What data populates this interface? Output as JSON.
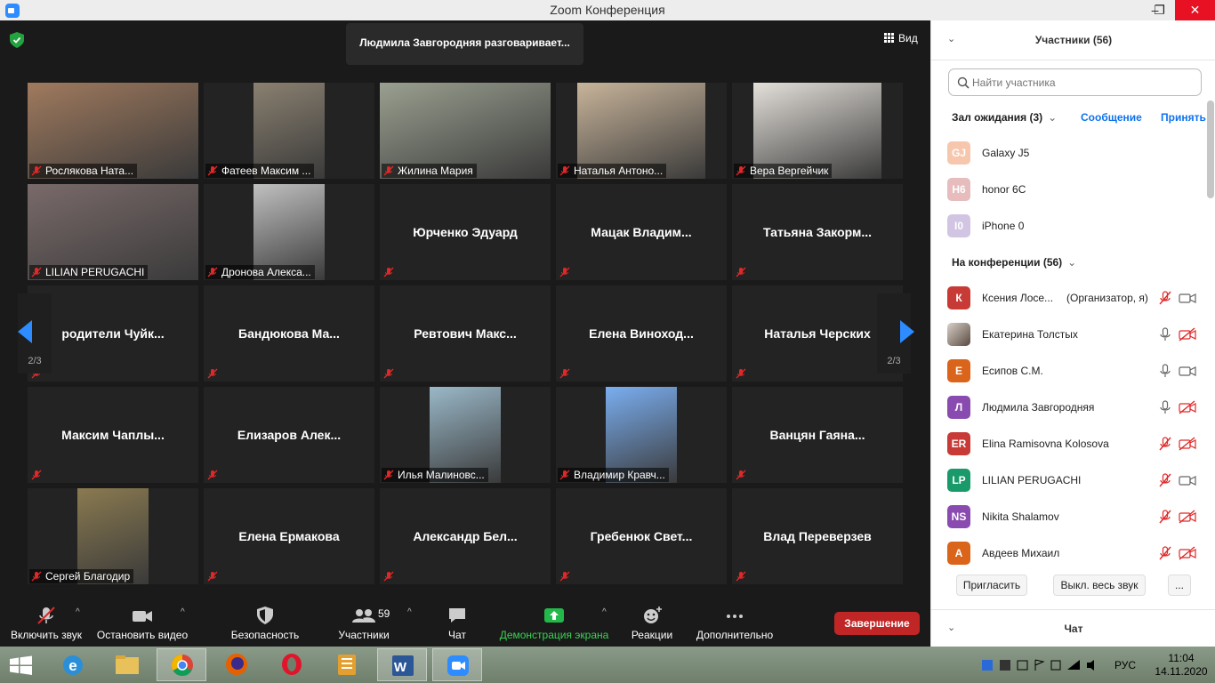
{
  "window": {
    "title": "Zoom Конференция",
    "min": "–",
    "max": "❐",
    "close": "✕"
  },
  "stage": {
    "speaking": "Людмила Завгородняя разговаривает...",
    "view_label": "Вид",
    "page_left": "2/3",
    "page_right": "2/3",
    "tiles": [
      {
        "label": "Рослякова Ната...",
        "video": true,
        "vcolor": "#a07a5e"
      },
      {
        "label": "Фатеев Максим ...",
        "video": true,
        "vcolor": "#8a8070"
      },
      {
        "label": "Жилина Мария",
        "video": true,
        "vcolor": "#9aa090"
      },
      {
        "label": "Наталья Антоно...",
        "video": true,
        "vcolor": "#c8b49a"
      },
      {
        "label": "Вера Вергейчик",
        "video": true,
        "vcolor": "#e4e0da"
      },
      {
        "label": "LILIAN PERUGACHI",
        "video": true,
        "vcolor": "#7a6a6a"
      },
      {
        "label": "Дронова Алекса...",
        "video": true,
        "vcolor": "#c0c0c0"
      },
      {
        "name": "Юрченко Эдуард"
      },
      {
        "name": "Мацак Владим..."
      },
      {
        "name": "Татьяна Закорм..."
      },
      {
        "name": "родители Чуйк..."
      },
      {
        "name": "Бандюкова Ма..."
      },
      {
        "name": "Ревтович Макс..."
      },
      {
        "name": "Елена Виноход..."
      },
      {
        "name": "Наталья Черских"
      },
      {
        "name": "Максим Чаплы..."
      },
      {
        "name": "Елизаров Алек..."
      },
      {
        "label": "Илья Малиновс...",
        "video": true,
        "vcolor": "#9ab8c8"
      },
      {
        "label": "Владимир Кравч...",
        "video": true,
        "vcolor": "#7aaef0"
      },
      {
        "name": "Ванцян Гаяна..."
      },
      {
        "label": "Сергей Благодир",
        "video": true,
        "vcolor": "#8a7a50"
      },
      {
        "name": "Елена Ермакова"
      },
      {
        "name": "Александр Бел..."
      },
      {
        "name": "Гребенюк Свет..."
      },
      {
        "name": "Влад Переверзев"
      }
    ]
  },
  "toolbar": {
    "unmute": "Включить звук",
    "stop_video": "Остановить видео",
    "security": "Безопасность",
    "participants": "Участники",
    "participants_count": "59",
    "chat": "Чат",
    "share": "Демонстрация экрана",
    "reactions": "Реакции",
    "more": "Дополнительно",
    "end": "Завершение"
  },
  "panel": {
    "title": "Участники (56)",
    "search_placeholder": "Найти участника",
    "waiting_title": "Зал ожидания (3)",
    "message_btn": "Сообщение",
    "admit_btn": "Принять",
    "waiting": [
      {
        "initials": "GJ",
        "name": "Galaxy J5",
        "color": "#f6c7ad"
      },
      {
        "initials": "H6",
        "name": "honor 6C",
        "color": "#e6bcbc"
      },
      {
        "initials": "I0",
        "name": "iPhone 0",
        "color": "#d2c5e4"
      }
    ],
    "inmeeting_title": "На конференции (56)",
    "participants": [
      {
        "initials": "К",
        "name": "Ксения Лосе...",
        "role": "(Организатор, я)",
        "color": "#c73a36",
        "mic": "muted",
        "cam": "on"
      },
      {
        "initials": "",
        "name": "Екатерина Толстых",
        "color": "#777",
        "mic": "on",
        "cam": "off",
        "photo": true
      },
      {
        "initials": "Е",
        "name": "Есипов С.М.",
        "color": "#d9641a",
        "mic": "on",
        "cam": "on"
      },
      {
        "initials": "Л",
        "name": "Людмила Завгородняя",
        "color": "#8a4bb0",
        "mic": "on",
        "cam": "off"
      },
      {
        "initials": "ER",
        "name": "Elina Ramisovna Kolosova",
        "color": "#c73a36",
        "mic": "muted",
        "cam": "off"
      },
      {
        "initials": "LP",
        "name": "LILIAN PERUGACHI",
        "color": "#1a9a6a",
        "mic": "muted",
        "cam": "on"
      },
      {
        "initials": "NS",
        "name": "Nikita Shalamov",
        "color": "#8a4bb0",
        "mic": "muted",
        "cam": "off"
      },
      {
        "initials": "А",
        "name": "Авдеев Михаил",
        "color": "#d9641a",
        "mic": "muted",
        "cam": "off"
      }
    ],
    "invite": "Пригласить",
    "mute_all": "Выкл. весь звук",
    "more": "...",
    "chat_title": "Чат"
  },
  "taskbar": {
    "lang": "РУС",
    "time": "11:04",
    "date": "14.11.2020"
  }
}
